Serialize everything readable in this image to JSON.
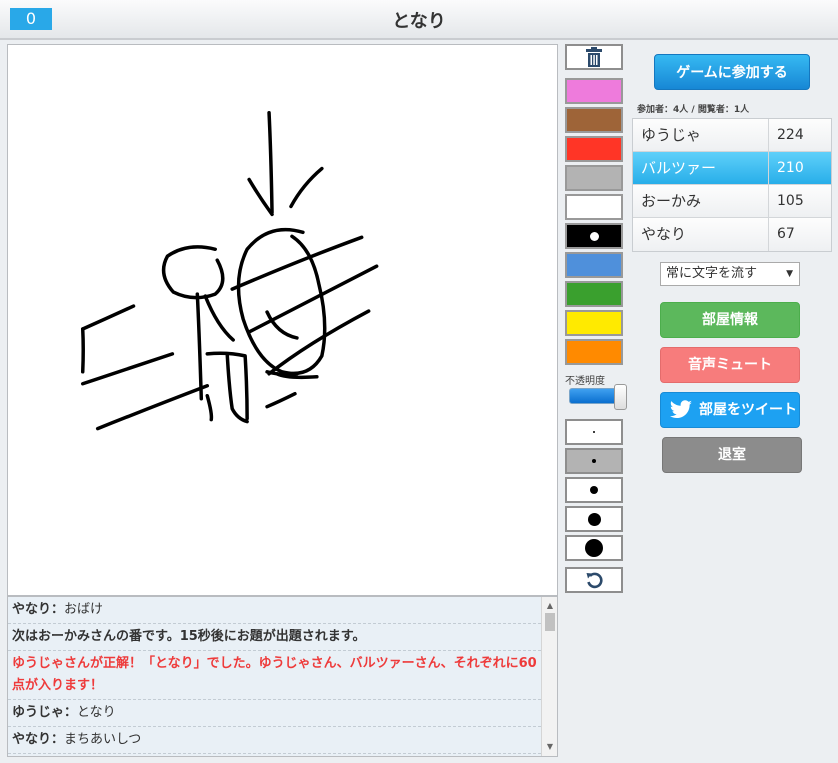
{
  "header": {
    "timer": "0",
    "title": "となり"
  },
  "toolbar": {
    "trash_icon": "trash-icon",
    "colors": [
      "#ee7bdc",
      "#9e6438",
      "#ff3526",
      "#b3b3b3",
      "#ffffff",
      "#000000",
      "#4f90db",
      "#3aa02e",
      "#ffea00",
      "#ff8a00"
    ],
    "opacity_label": "不透明度",
    "opacity_value": 1.0,
    "undo_icon": "undo-icon"
  },
  "join_button": "ゲームに参加する",
  "counts_text": "参加者：4人 / 閲覧者：1人",
  "players": [
    {
      "name": "ゆうじゃ",
      "score": "224"
    },
    {
      "name": "バルツァー",
      "score": "210"
    },
    {
      "name": "おーかみ",
      "score": "105"
    },
    {
      "name": "やなり",
      "score": "67"
    }
  ],
  "text_flow_select": "常に文字を流す",
  "buttons": {
    "room_info": "部屋情報",
    "mute": "音声ミュート",
    "tweet": "部屋をツイート",
    "leave": "退室"
  },
  "chat": [
    {
      "name": "やなり：",
      "text": "おばけ"
    },
    {
      "text": "次はおーかみさんの番です。15秒後にお題が出題されます。"
    },
    {
      "text": "ゆうじゃさんが正解！「となり」でした。ゆうじゃさん、バルツァーさん、それぞれに60点が入ります！"
    },
    {
      "name": "ゆうじゃ：",
      "text": "となり"
    },
    {
      "name": "やなり：",
      "text": "まちあいしつ"
    }
  ]
}
